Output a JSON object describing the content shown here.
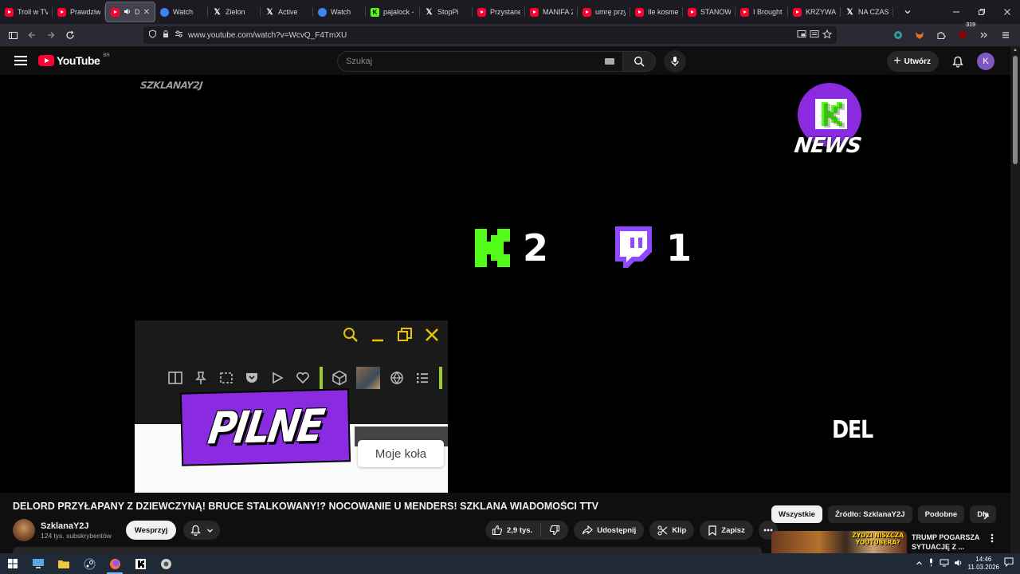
{
  "browser": {
    "tabs": [
      {
        "label": "Troll w TV!",
        "icon": "youtube-icon",
        "active": false
      },
      {
        "label": "Prawdziwy",
        "icon": "youtube-icon",
        "active": false
      },
      {
        "label": "DEL",
        "icon": "youtube-icon",
        "active": true,
        "audio": true
      },
      {
        "label": "Watch",
        "icon": "watch-icon",
        "active": false
      },
      {
        "label": "Zielon",
        "icon": "x-icon",
        "active": false
      },
      {
        "label": "Active",
        "icon": "x-icon",
        "active": false
      },
      {
        "label": "Watch",
        "icon": "watch-icon",
        "active": false
      },
      {
        "label": "pajalock -",
        "icon": "kick-icon",
        "active": false
      },
      {
        "label": "StopPi",
        "icon": "x-icon",
        "active": false
      },
      {
        "label": "Przystanek",
        "icon": "youtube-icon",
        "active": false
      },
      {
        "label": "MANIFA 2(",
        "icon": "youtube-icon",
        "active": false
      },
      {
        "label": "umrę przy",
        "icon": "youtube-icon",
        "active": false
      },
      {
        "label": "Ile kosmety",
        "icon": "youtube-icon",
        "active": false
      },
      {
        "label": "STANOWS",
        "icon": "youtube-icon",
        "active": false
      },
      {
        "label": "I Brought I",
        "icon": "youtube-icon",
        "active": false
      },
      {
        "label": "KRZYWA A",
        "icon": "youtube-icon",
        "active": false
      },
      {
        "label": "NA CZASIE",
        "icon": "x-icon",
        "active": false
      }
    ],
    "url": "www.youtube.com/watch?v=WcvQ_F4TmXU",
    "extension_badge": "319"
  },
  "youtube": {
    "logo_text": "YouTube",
    "region": "BR",
    "search_placeholder": "Szukaj",
    "create_label": "Utwórz",
    "avatar_letter": "K"
  },
  "video": {
    "watermark": "SZKLANAY2J",
    "news_label": "NEWS",
    "kick_score": "2",
    "twitch_score": "1",
    "del_caption": "DEL",
    "pilne_label": "PILNE",
    "inset_button_label": "Moje koła"
  },
  "details": {
    "title": "DELORD PRZYŁAPANY Z DZIEWCZYNĄ! BRUCE STALKOWANY!? NOCOWANIE U MENDERS! SZKLANA WIADOMOŚCI TTV",
    "channel_name": "SzklanaY2J",
    "subscribers": "124 tys. subskrybentów",
    "support_label": "Wesprzyj",
    "likes": "2,9 tys.",
    "share_label": "Udostępnij",
    "clip_label": "Klip",
    "save_label": "Zapisz"
  },
  "sidebar": {
    "chips": [
      {
        "label": "Wszystkie",
        "selected": true
      },
      {
        "label": "Źródło: SzklanaY2J",
        "selected": false
      },
      {
        "label": "Podobne",
        "selected": false
      },
      {
        "label": "Dla",
        "selected": false
      }
    ],
    "suggestion": {
      "thumb_text_line1": "ŻYDZI NISZCZĄ",
      "thumb_text_line2": "YOUTUBERA?",
      "title_line1": "TRUMP POGARSZA",
      "title_line2": "SYTUACJĘ Z ..."
    }
  },
  "taskbar": {
    "time": "14:46",
    "date": "11.03.2026"
  },
  "colors": {
    "youtube_red": "#ff0033",
    "kick_green": "#53fc18",
    "twitch_purple": "#9146ff",
    "pilne_purple": "#8a2be2",
    "background": "#0f0f0f"
  }
}
